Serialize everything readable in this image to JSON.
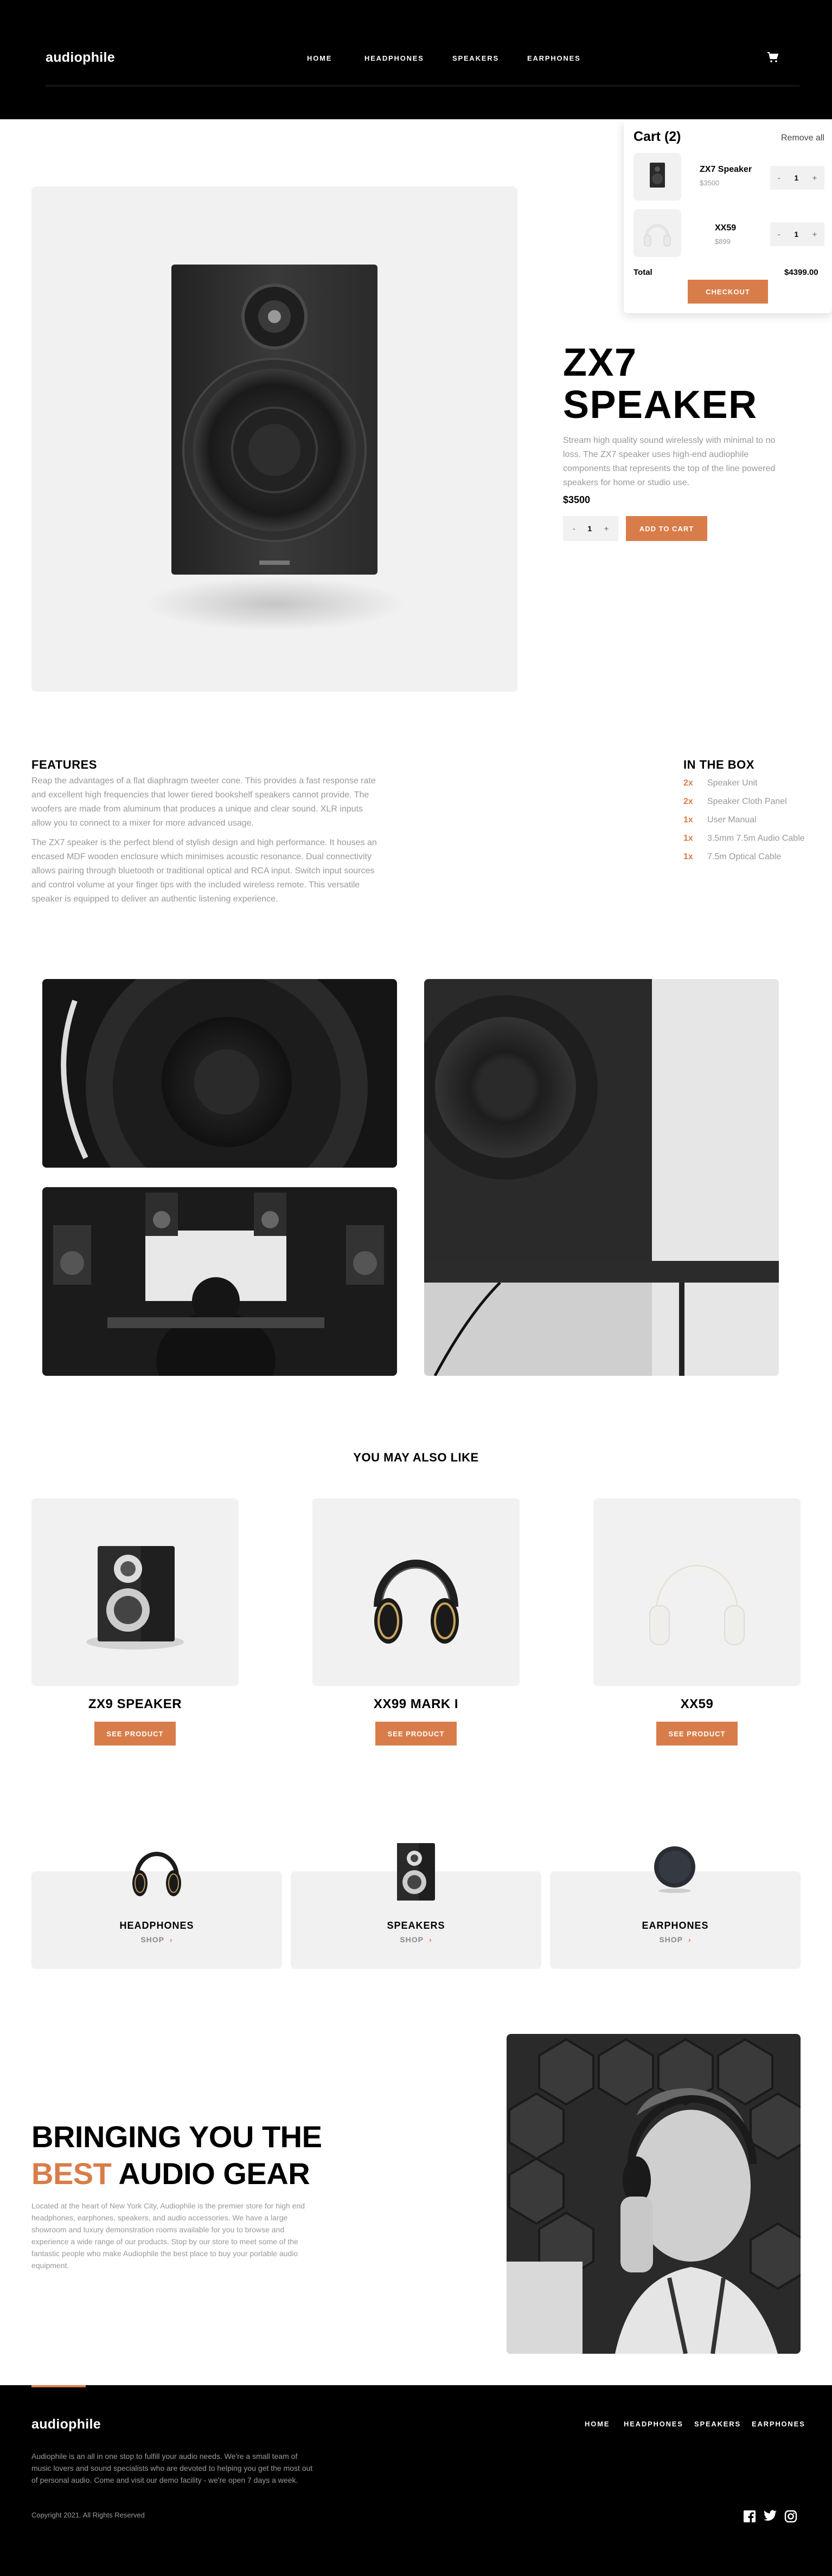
{
  "brand": {
    "logo": "audiophile",
    "accent_color": "#d87d4a"
  },
  "header": {
    "nav": [
      "HOME",
      "HEADPHONES",
      "SPEAKERS",
      "EARPHONES"
    ],
    "cart_icon": "cart-icon"
  },
  "cart": {
    "title": "Cart (2)",
    "remove_all": "Remove all",
    "items": [
      {
        "name": "ZX7 Speaker",
        "price": "$3500",
        "qty": "1"
      },
      {
        "name": "XX59",
        "price": "$899",
        "qty": "1"
      }
    ],
    "total_label": "Total",
    "total_value": "$4399.00",
    "checkout": "CHECKOUT"
  },
  "product": {
    "title_line1": "ZX7",
    "title_line2": "SPEAKER",
    "description": "Stream high quality sound wirelessly with minimal to no loss. The ZX7 speaker uses high-end audiophile components that represents the top of the line powered speakers for home or studio use.",
    "price": "$3500",
    "qty": "1",
    "add_to_cart": "ADD TO CART"
  },
  "features": {
    "title": "FEATURES",
    "paragraph1": "Reap the advantages of a flat diaphragm tweeter cone. This provides a fast response rate and excellent high frequencies that lower tiered bookshelf speakers cannot provide. The woofers are made from aluminum that produces a unique and clear sound. XLR inputs allow you to connect to a mixer for more advanced usage.",
    "paragraph2": "The ZX7 speaker is the perfect blend of stylish design and high performance. It houses an encased MDF wooden enclosure which minimises acoustic resonance. Dual connectivity allows pairing through bluetooth or traditional optical and RCA input. Switch input sources and control volume at your finger tips with the included wireless remote. This versatile speaker is equipped to deliver an authentic listening experience."
  },
  "in_the_box": {
    "title": "IN THE BOX",
    "items": [
      {
        "qty": "2x",
        "item": "Speaker Unit"
      },
      {
        "qty": "2x",
        "item": "Speaker Cloth Panel"
      },
      {
        "qty": "1x",
        "item": "User Manual"
      },
      {
        "qty": "1x",
        "item": "3.5mm 7.5m Audio Cable"
      },
      {
        "qty": "1x",
        "item": "7.5m Optical Cable"
      }
    ]
  },
  "also_like": {
    "title": "YOU MAY ALSO LIKE",
    "products": [
      {
        "name": "ZX9 SPEAKER",
        "button": "SEE PRODUCT"
      },
      {
        "name": "XX99 MARK I",
        "button": "SEE PRODUCT"
      },
      {
        "name": "XX59",
        "button": "SEE PRODUCT"
      }
    ]
  },
  "categories": [
    {
      "name": "HEADPHONES",
      "shop": "SHOP"
    },
    {
      "name": "SPEAKERS",
      "shop": "SHOP"
    },
    {
      "name": "EARPHONES",
      "shop": "SHOP"
    }
  ],
  "about": {
    "title_line1": "BRINGING YOU THE",
    "title_accent": "BEST",
    "title_rest": " AUDIO GEAR",
    "text": "Located at the heart of New York City, Audiophile is the premier store for high end headphones, earphones, speakers, and audio accessories. We have a large showroom and luxury demonstration rooms available for you to browse and experience a wide range of our products. Stop by our store to meet some of the fantastic people who make Audiophile the best place to buy your portable audio equipment."
  },
  "footer": {
    "logo": "audiophile",
    "nav": [
      "HOME",
      "HEADPHONES",
      "SPEAKERS",
      "EARPHONES"
    ],
    "text": "Audiophile is an all in one stop to fulfill your audio needs. We're a small team of music lovers and sound specialists who are devoted to helping you get the most out of personal audio. Come and visit our demo facility - we're open 7 days a week.",
    "copyright": "Copyright 2021. All Rights Reserved",
    "social": [
      "facebook-icon",
      "twitter-icon",
      "instagram-icon"
    ]
  }
}
